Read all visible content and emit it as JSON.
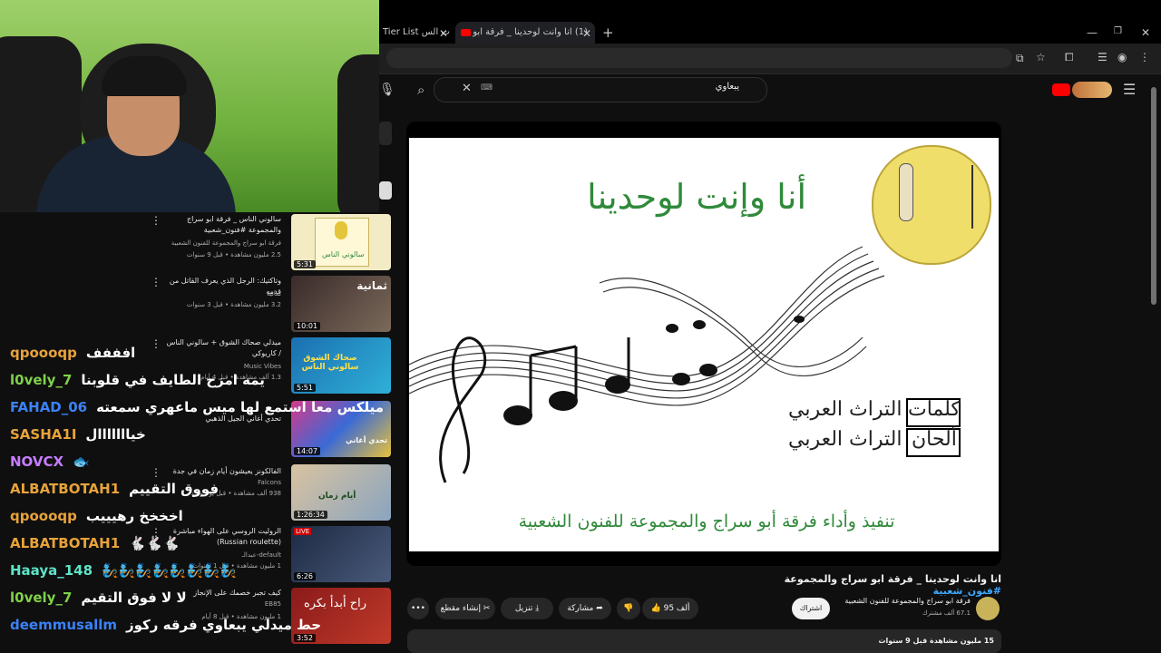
{
  "browser": {
    "tabs": [
      {
        "label": "Tier List ترات الس"
      },
      {
        "label": "(1) انا وانت لوحدينا _ فرقة ابو"
      }
    ],
    "new_tab": "+",
    "window_controls": [
      "—",
      "❐",
      "✕"
    ]
  },
  "youtube": {
    "search_value": "يبعاوي",
    "channel_avatar_text": "شعار",
    "video": {
      "title_main": "انا وانت لوحدينا _ فرقة ابو سراج والمجموعة",
      "title_hashtag": "#فنون_شعبية",
      "image_text": {
        "title": "أنا وإنت لوحدينا",
        "credit1_label": "كلمات",
        "credit1_value": "التراث العربي",
        "credit2_label": "ألحان",
        "credit2_value": "التراث العربي",
        "performer": "تنفيذ وأداء فرقة أبو سراج والمجموعة للفنون الشعبية"
      },
      "channel_name": "فرقة ابو سراج والمجموعة للفنون الشعبية",
      "subscribers": "67.1 ألف مشترك",
      "subscribe_label": "اشتراك",
      "like_count": "95 ألف",
      "share_label": "مشاركة",
      "download_label": "تنزيل",
      "clip_label": "إنشاء مقطع",
      "more_label": "•••",
      "views_date": "15 مليون مشاهدة  قبل 9 سنوات"
    },
    "related": [
      {
        "title": "سالوني الناس _ فرقة ابو سراج والمجموعة #فنون_شعبية",
        "channel": "فرقة ابو سراج والمجموعة للفنون الشعبية",
        "meta": "2.5 مليون مشاهدة • قبل 9 سنوات",
        "duration": "5:31"
      },
      {
        "title": "وتاكتيك: الرجل الذي يعرف القاتل من قدمه",
        "channel": "ثمانية",
        "meta": "3.2 مليون مشاهدة • قبل 3 سنوات",
        "duration": "10:01"
      },
      {
        "title": "ميدلي صحاك الشوق + سالوني الناس / كاريوكي",
        "channel": "Music Vibes",
        "meta": "1.3 ألف مشاهدة • قبل 4 أيام",
        "duration": "5:51"
      },
      {
        "title": "تحدي أغاني الجيل الذهبي",
        "channel": "",
        "meta": "",
        "duration": "14:07"
      },
      {
        "title": "الفالكونز يعيشون أيام زمان في جدة",
        "channel": "Falcons",
        "meta": "938 ألف مشاهدة • قبل يوم واحد",
        "duration": "1:26:34"
      },
      {
        "title": "الروليت الروسي على الهواء مباشرة (Russian roulette)",
        "channel": "default-عبدالـ",
        "meta": "1 مليون مشاهدة • قبل 1 سنوات",
        "duration": "6:26"
      },
      {
        "title": "كيف تجبر خصمك على الإنجاز",
        "channel": "EB85",
        "meta": "1 مليون مشاهدة • قبل 8 أيام",
        "duration": "3:52"
      }
    ],
    "related_thumb_texts": [
      "سالوني الناس",
      "ثمانية",
      "صحاك الشوق سالوني الناس",
      "تحدي أغاني",
      "أيام زمان",
      "LIVE",
      "راح أبدأ بكره"
    ]
  },
  "chat": [
    {
      "user": "qpoooqp",
      "color": "#e8a33a",
      "msg": "افففف"
    },
    {
      "user": "l0vely_7",
      "color": "#7fd14a",
      "msg": "يمه امزح الطايف في قلوبنا"
    },
    {
      "user": "FAHAD_06",
      "color": "#3b82f6",
      "msg": "ميلكس معا استمع لها ميس ماعهري سمعته"
    },
    {
      "user": "SASHA1I",
      "color": "#e8a33a",
      "msg": "خيااااااال"
    },
    {
      "user": "NOVCX",
      "color": "#c77dff",
      "msg": "🐟"
    },
    {
      "user": "ALBATBOTAH1",
      "color": "#e8a33a",
      "msg": "فووق التقييم"
    },
    {
      "user": "qpoooqp",
      "color": "#e8a33a",
      "msg": "اخخخخ رهيييب"
    },
    {
      "user": "ALBATBOTAH1",
      "color": "#e8a33a",
      "msg": "🐇🐇🐇"
    },
    {
      "user": "Haaya_148",
      "color": "#5fe3c8",
      "msg": "🧞🧞🧞🧞🧞🧞🧞🧞"
    },
    {
      "user": "l0vely_7",
      "color": "#7fd14a",
      "msg": "لا لا فوق التقيم"
    },
    {
      "user": "deemmusallm",
      "color": "#3b82f6",
      "msg": "حط ميدلي يبعاوي فرقه ركوز"
    }
  ]
}
